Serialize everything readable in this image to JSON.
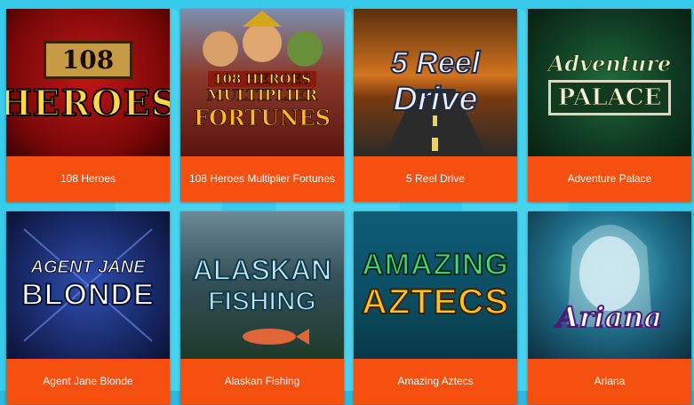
{
  "games": [
    {
      "title": "108 Heroes",
      "art": [
        "108",
        "HEROES"
      ]
    },
    {
      "title": "108 Heroes Multiplier Fortunes",
      "art": [
        "108 HEROES",
        "MULTIPLIER",
        "FORTUNES"
      ]
    },
    {
      "title": "5 Reel Drive",
      "art": [
        "5 Reel",
        "Drive"
      ]
    },
    {
      "title": "Adventure Palace",
      "art": [
        "Adventure",
        "PALACE"
      ]
    },
    {
      "title": "Agent Jane Blonde",
      "art": [
        "AGENT JANE",
        "BLONDE"
      ]
    },
    {
      "title": "Alaskan Fishing",
      "art": [
        "ALASKAN",
        "FISHING"
      ]
    },
    {
      "title": "Amazing Aztecs",
      "art": [
        "AMAZING",
        "AZTECS"
      ]
    },
    {
      "title": "Ariana",
      "art": [
        "Ariana"
      ]
    }
  ],
  "colors": {
    "page_bg": "#35c9ea",
    "label_bg": "#f5500f",
    "label_text": "#ffffff"
  }
}
